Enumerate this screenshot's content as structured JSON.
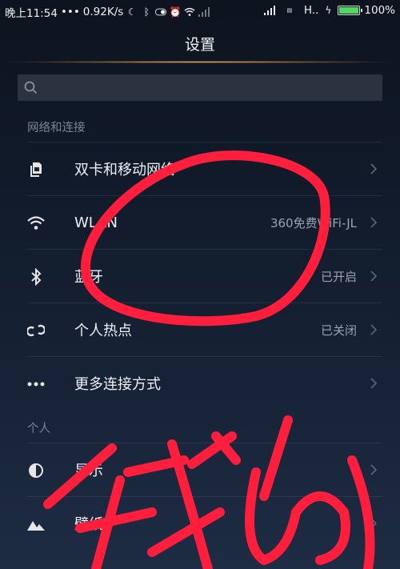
{
  "status": {
    "time": "晚上11:54",
    "dots": "•••",
    "speed": "0.92K/s",
    "carrier": "H..",
    "battery": "100%",
    "battery_level": 1.0
  },
  "header": {
    "title": "设置"
  },
  "search": {
    "placeholder": ""
  },
  "sections": {
    "network": "网络和连接",
    "personal": "个人"
  },
  "rows": [
    {
      "label": "双卡和移动网络",
      "value": "",
      "icon": "sim-cards-icon"
    },
    {
      "label": "WLAN",
      "value": "360免费WiFi-JL",
      "icon": "wifi-icon"
    },
    {
      "label": "蓝牙",
      "value": "已开启",
      "icon": "bluetooth-icon"
    },
    {
      "label": "个人热点",
      "value": "已关闭",
      "icon": "hotspot-icon"
    },
    {
      "label": "更多连接方式",
      "value": "",
      "icon": "more-icon"
    },
    {
      "label": "显示",
      "value": "",
      "icon": "display-icon"
    },
    {
      "label": "壁纸",
      "value": "",
      "icon": "wallpaper-icon"
    }
  ],
  "colors": {
    "scribble": "#ff1e3c",
    "glow": "#ffc878"
  }
}
